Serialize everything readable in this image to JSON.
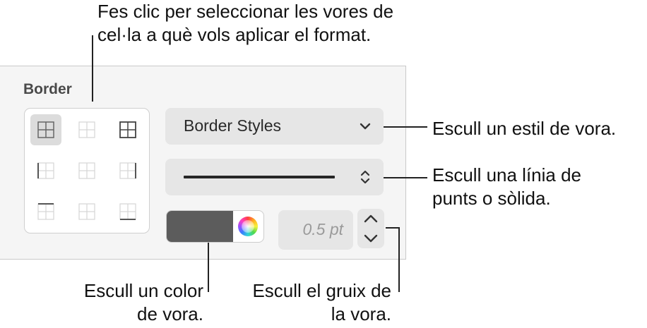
{
  "callouts": {
    "select_borders": [
      "Fes clic per seleccionar les vores de",
      "cel·la a què vols aplicar el format."
    ],
    "border_style": [
      "Escull un estil de vora."
    ],
    "line_type": [
      "Escull una línia de",
      "punts o sòlida."
    ],
    "border_color": [
      "Escull un color",
      "de vora."
    ],
    "border_width": [
      "Escull el gruix de",
      "la vora."
    ]
  },
  "panel": {
    "section_title": "Border",
    "border_grid": {
      "selected": "all-borders",
      "cells": [
        {
          "name": "all-borders",
          "icon": "all-borders-icon"
        },
        {
          "name": "inside-borders",
          "icon": "inside-borders-icon"
        },
        {
          "name": "outside-borders",
          "icon": "outside-borders-icon"
        },
        {
          "name": "left-border",
          "icon": "left-border-icon"
        },
        {
          "name": "vertical-inside-border",
          "icon": "vertical-inside-border-icon"
        },
        {
          "name": "right-border",
          "icon": "right-border-icon"
        },
        {
          "name": "top-border",
          "icon": "top-border-icon"
        },
        {
          "name": "horizontal-inside-border",
          "icon": "horizontal-inside-border-icon"
        },
        {
          "name": "bottom-border",
          "icon": "bottom-border-icon"
        }
      ]
    },
    "border_styles_popup": {
      "label": "Border Styles",
      "icon": "chevron-down-icon"
    },
    "line_style_popup": {
      "value": "solid",
      "icon": "up-down-chevron-icon"
    },
    "color_well": {
      "color": "#5c5c5c",
      "icon": "color-wheel-icon"
    },
    "width_field": {
      "value": "0.5 pt"
    },
    "stepper": {
      "up_icon": "chevron-up-icon",
      "down_icon": "chevron-down-icon"
    }
  },
  "colors": {
    "panel_bg": "#f5f5f5",
    "control_bg": "#e6e6e6",
    "selected_cell": "#dcdcdc"
  }
}
